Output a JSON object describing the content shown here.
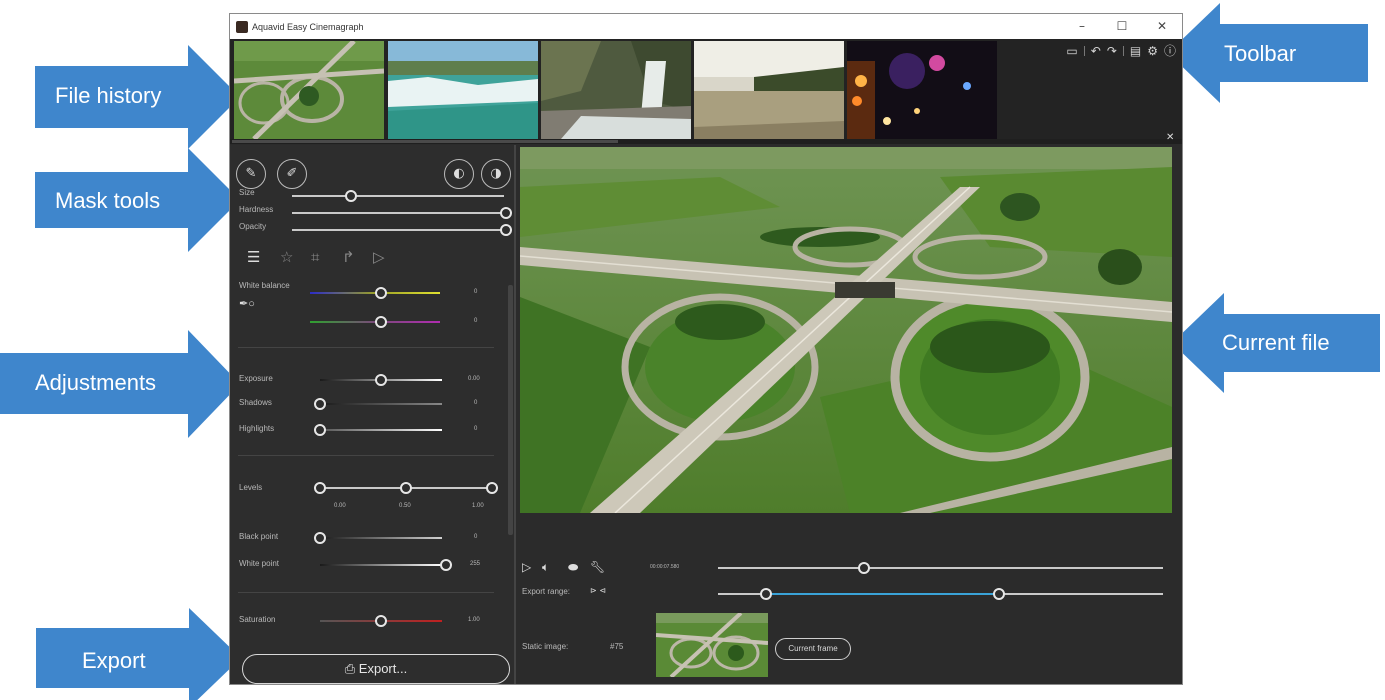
{
  "window": {
    "title": "Aquavid Easy Cinemagraph",
    "controls": [
      "–",
      "☐",
      "✕"
    ]
  },
  "callouts": {
    "file_history": "File history",
    "mask_tools": "Mask tools",
    "adjustments": "Adjustments",
    "export": "Export",
    "toolbar": "Toolbar",
    "current_file": "Current file"
  },
  "colors": {
    "callout_blue": "#3f86cc",
    "window_bg": "#2b2b2b",
    "panel_bg": "#2d2d2d",
    "accent_track": "#3aa3d8"
  },
  "file_history": {
    "thumbnails": [
      "highway-interchange",
      "waterfall-river",
      "mountain-waterfall",
      "lake-shore",
      "night-city-lights"
    ]
  },
  "toolbar": {
    "icons": [
      "window-icon",
      "undo-icon",
      "redo-icon",
      "image-icon",
      "settings-icon",
      "info-icon"
    ]
  },
  "mask_tools": {
    "size_label": "Size",
    "hardness_label": "Hardness",
    "opacity_label": "Opacity",
    "size_level": 0.25,
    "hardness_level": 1.0,
    "opacity_level": 1.0
  },
  "adjustments": {
    "white_balance_label": "White balance",
    "wb_temp_value": "0",
    "wb_tint_value": "0",
    "exposure_label": "Exposure",
    "exposure_value": "0.00",
    "shadows_label": "Shadows",
    "shadows_value": "0",
    "highlights_label": "Highlights",
    "highlights_value": "0",
    "levels_label": "Levels",
    "levels_ticks": [
      "0.00",
      "0.50",
      "1.00"
    ],
    "black_point_label": "Black point",
    "black_point_value": "0",
    "white_point_label": "White point",
    "white_point_value": "255",
    "saturation_label": "Saturation",
    "saturation_value": "1.00"
  },
  "export": {
    "label": "Export..."
  },
  "playback": {
    "timecode": "00:00:07.580",
    "export_range_label": "Export range:",
    "static_image_label": "Static image:",
    "static_image_frame": "#75",
    "current_frame_label": "Current frame"
  }
}
